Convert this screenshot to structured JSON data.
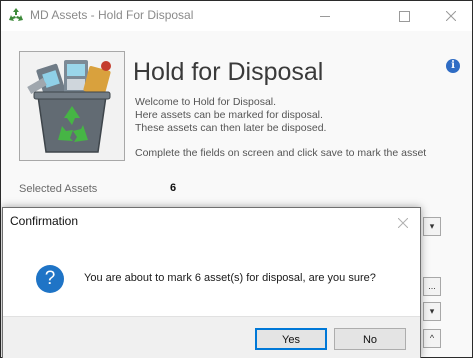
{
  "window": {
    "title": "MD Assets - Hold For Disposal"
  },
  "header": {
    "title": "Hold for Disposal",
    "intro_lines": [
      "Welcome to Hold for Disposal.",
      "Here assets can be marked for disposal.",
      "These assets can then later be disposed."
    ],
    "instruction": "Complete the fields on screen and click save to mark the asset"
  },
  "form": {
    "selected_assets_label": "Selected Assets",
    "selected_assets_value": "6"
  },
  "dialog": {
    "title": "Confirmation",
    "message": "You are about to mark 6 asset(s) for disposal, are you sure?",
    "yes_label": "Yes",
    "no_label": "No",
    "icon": "question-icon"
  },
  "icons": {
    "info": "i",
    "question": "?",
    "side_controls": [
      "▾",
      "...",
      "▾",
      "^"
    ]
  },
  "colors": {
    "accent": "#0078d7",
    "question_icon": "#1f74c6",
    "info_icon": "#2f6cc4"
  }
}
